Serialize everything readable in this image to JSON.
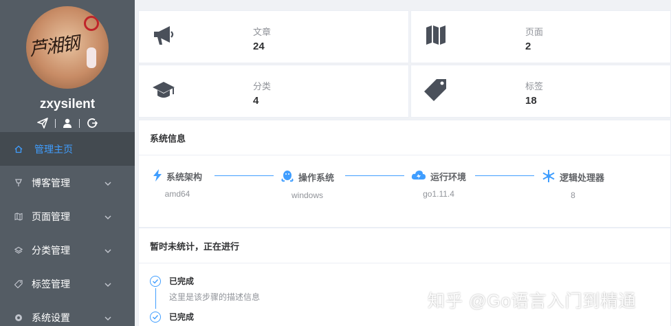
{
  "profile": {
    "username": "zxysilent",
    "avatar_signature": "芦湘钢",
    "icons": [
      "paper-plane-icon",
      "user-icon",
      "logout-icon"
    ]
  },
  "sidebar": {
    "items": [
      {
        "label": "管理主页",
        "icon": "home-icon",
        "active": true
      },
      {
        "label": "博客管理",
        "icon": "pin-icon",
        "active": false
      },
      {
        "label": "页面管理",
        "icon": "map-icon",
        "active": false
      },
      {
        "label": "分类管理",
        "icon": "layers-icon",
        "active": false
      },
      {
        "label": "标签管理",
        "icon": "tag-icon",
        "active": false
      },
      {
        "label": "系统设置",
        "icon": "settings-icon",
        "active": false
      }
    ]
  },
  "stats": [
    {
      "label": "文章",
      "value": "24",
      "icon": "megaphone-icon"
    },
    {
      "label": "页面",
      "value": "2",
      "icon": "map-icon"
    },
    {
      "label": "分类",
      "value": "4",
      "icon": "graduation-cap-icon"
    },
    {
      "label": "标签",
      "value": "18",
      "icon": "tag-icon"
    }
  ],
  "system_info": {
    "title": "系统信息",
    "steps": [
      {
        "label": "系统架构",
        "value": "amd64",
        "icon": "lightning-icon"
      },
      {
        "label": "操作系统",
        "value": "windows",
        "icon": "penguin-icon"
      },
      {
        "label": "运行环境",
        "value": "go1.11.4",
        "icon": "cloud-icon"
      },
      {
        "label": "逻辑处理器",
        "value": "8",
        "icon": "snowflake-icon"
      }
    ]
  },
  "progress": {
    "title": "暂时未统计，正在进行",
    "items": [
      {
        "title": "已完成",
        "desc": "这里是该步骤的描述信息"
      },
      {
        "title": "已完成",
        "desc": ""
      }
    ]
  },
  "watermark": "知乎 @Go语言入门到精通",
  "colors": {
    "sidebar": "#545c64",
    "active_bg": "#434a50",
    "accent": "#409eff"
  }
}
